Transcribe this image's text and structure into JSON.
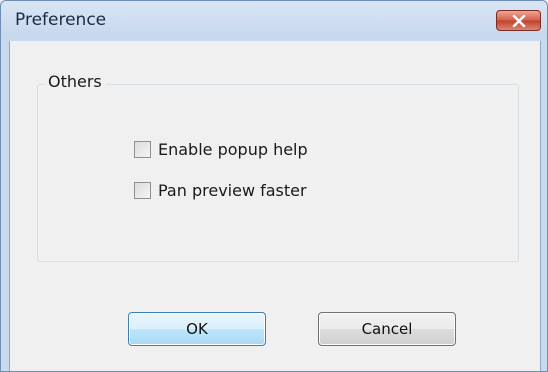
{
  "window": {
    "title": "Preference",
    "close_icon": "close-icon"
  },
  "group": {
    "label": "Others",
    "options": [
      {
        "label": "Enable popup help",
        "checked": false
      },
      {
        "label": "Pan preview faster",
        "checked": false
      }
    ]
  },
  "buttons": {
    "ok_label": "OK",
    "cancel_label": "Cancel"
  },
  "colors": {
    "title_bar": "#c9d9ee",
    "close_button": "#c2422d",
    "client_background": "#f0f0f0",
    "default_button_border": "#3c7fb1"
  }
}
